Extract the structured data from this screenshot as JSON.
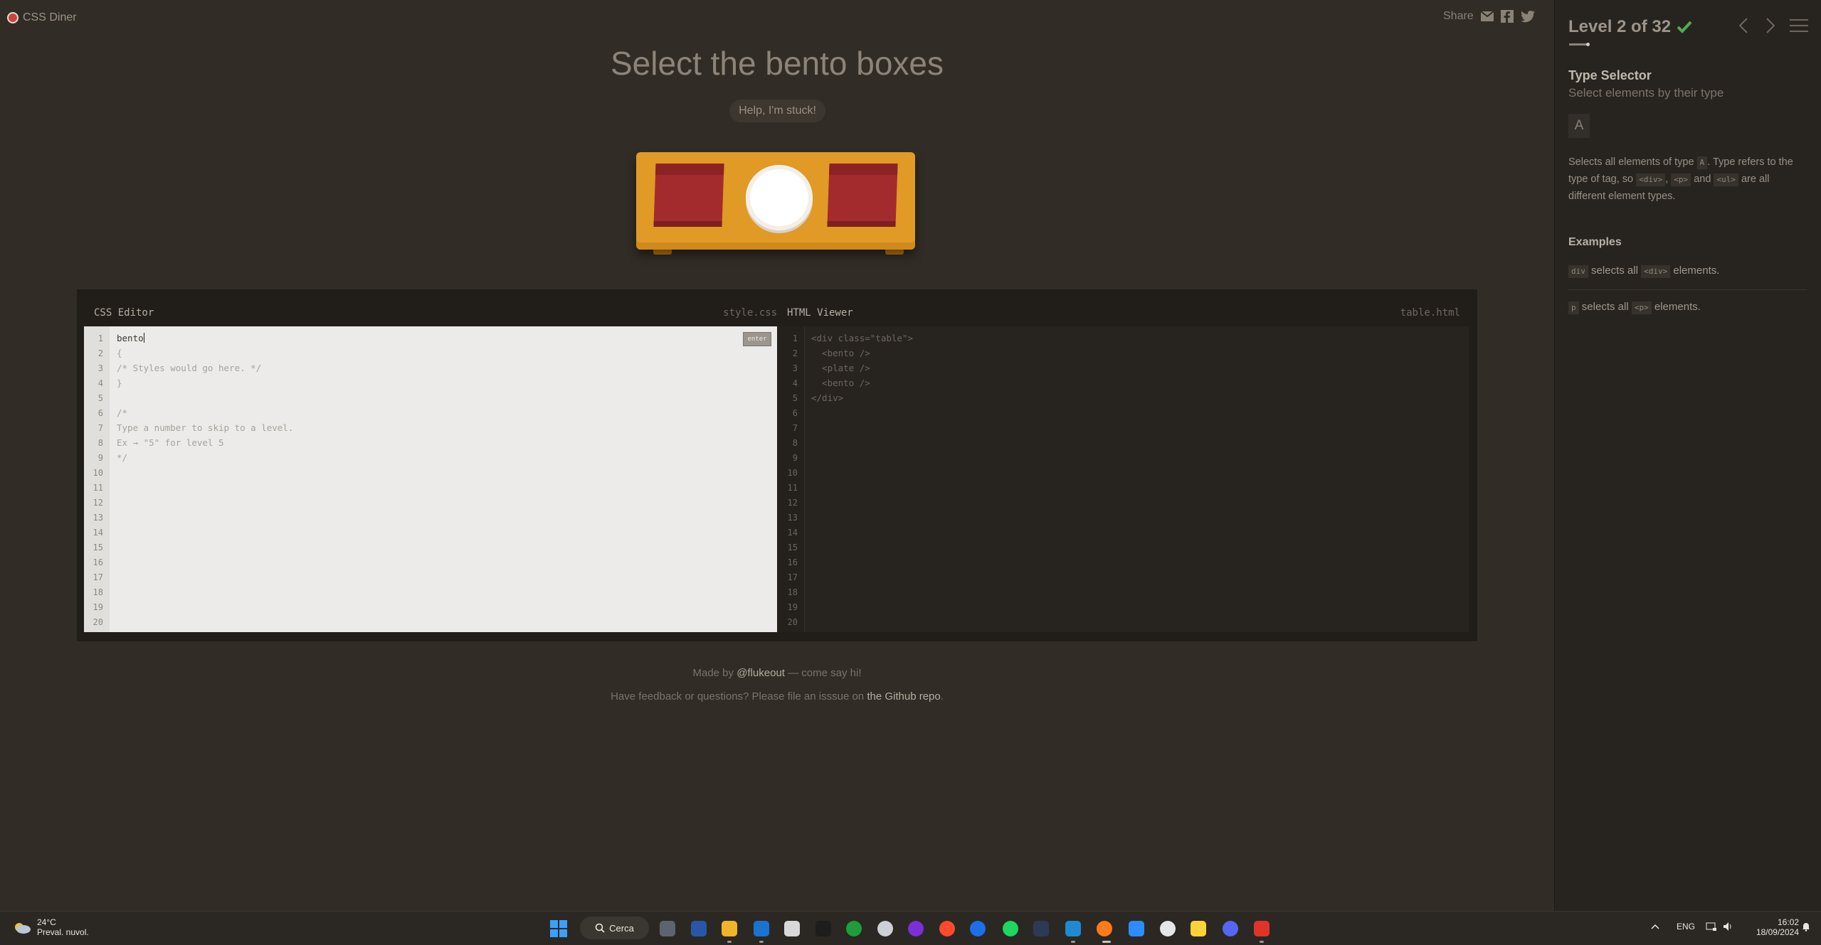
{
  "header": {
    "brand": "CSS Diner",
    "share_label": "Share"
  },
  "main": {
    "instruction": "Select the bento boxes",
    "help_label": "Help, I'm stuck!"
  },
  "css_editor": {
    "title": "CSS Editor",
    "filename": "style.css",
    "input_value": "bento",
    "enter_label": "enter",
    "lines": [
      "{",
      "/* Styles would go here. */",
      "}",
      "",
      "/*",
      "Type a number to skip to a level.",
      "Ex → \"5\" for level 5",
      "*/"
    ],
    "line_numbers": [
      "1",
      "2",
      "3",
      "4",
      "5",
      "6",
      "7",
      "8",
      "9",
      "10",
      "11",
      "12",
      "13",
      "14",
      "15",
      "16",
      "17",
      "18",
      "19",
      "20"
    ]
  },
  "html_viewer": {
    "title": "HTML Viewer",
    "filename": "table.html",
    "lines": [
      "<div class=\"table\">",
      "  <bento />",
      "  <plate />",
      "  <bento />",
      "</div>"
    ],
    "line_numbers": [
      "1",
      "2",
      "3",
      "4",
      "5",
      "6",
      "7",
      "8",
      "9",
      "10",
      "11",
      "12",
      "13",
      "14",
      "15",
      "16",
      "17",
      "18",
      "19",
      "20"
    ]
  },
  "footer": {
    "made_by_prefix": "Made by",
    "made_by_link": "@flukeout",
    "made_by_suffix": "— come say hi!",
    "feedback_prefix": "Have feedback or questions? Please file an isssue on",
    "feedback_link": "the Github repo",
    "feedback_suffix": "."
  },
  "sidebar": {
    "level_label": "Level 2 of 32",
    "level_complete": true,
    "selector_name": "Type Selector",
    "selector_desc": "Select elements by their type",
    "syntax": "A",
    "explain_1": "Selects all elements of type",
    "explain_tag": "A",
    "explain_2": ". Type refers to the type of tag, so",
    "explain_div": "<div>",
    "explain_comma": ",",
    "explain_p": "<p>",
    "explain_and": "and",
    "explain_ul": "<ul>",
    "explain_3": "are all different element types.",
    "examples_title": "Examples",
    "ex1_code": "div",
    "ex1_text": "selects all",
    "ex1_tag": "<div>",
    "ex1_end": "elements.",
    "ex2_code": "p",
    "ex2_text": "selects all",
    "ex2_tag": "<p>",
    "ex2_end": "elements."
  },
  "taskbar": {
    "temperature": "24°C",
    "weather_desc": "Preval. nuvol.",
    "search_label": "Cerca",
    "language": "ENG",
    "time": "16:02",
    "date": "18/09/2024"
  },
  "colors": {
    "background": "#312c26",
    "sidebar": "#272420",
    "table": "#e09a25",
    "bento": "#a42b2d",
    "check": "#4caf50"
  }
}
